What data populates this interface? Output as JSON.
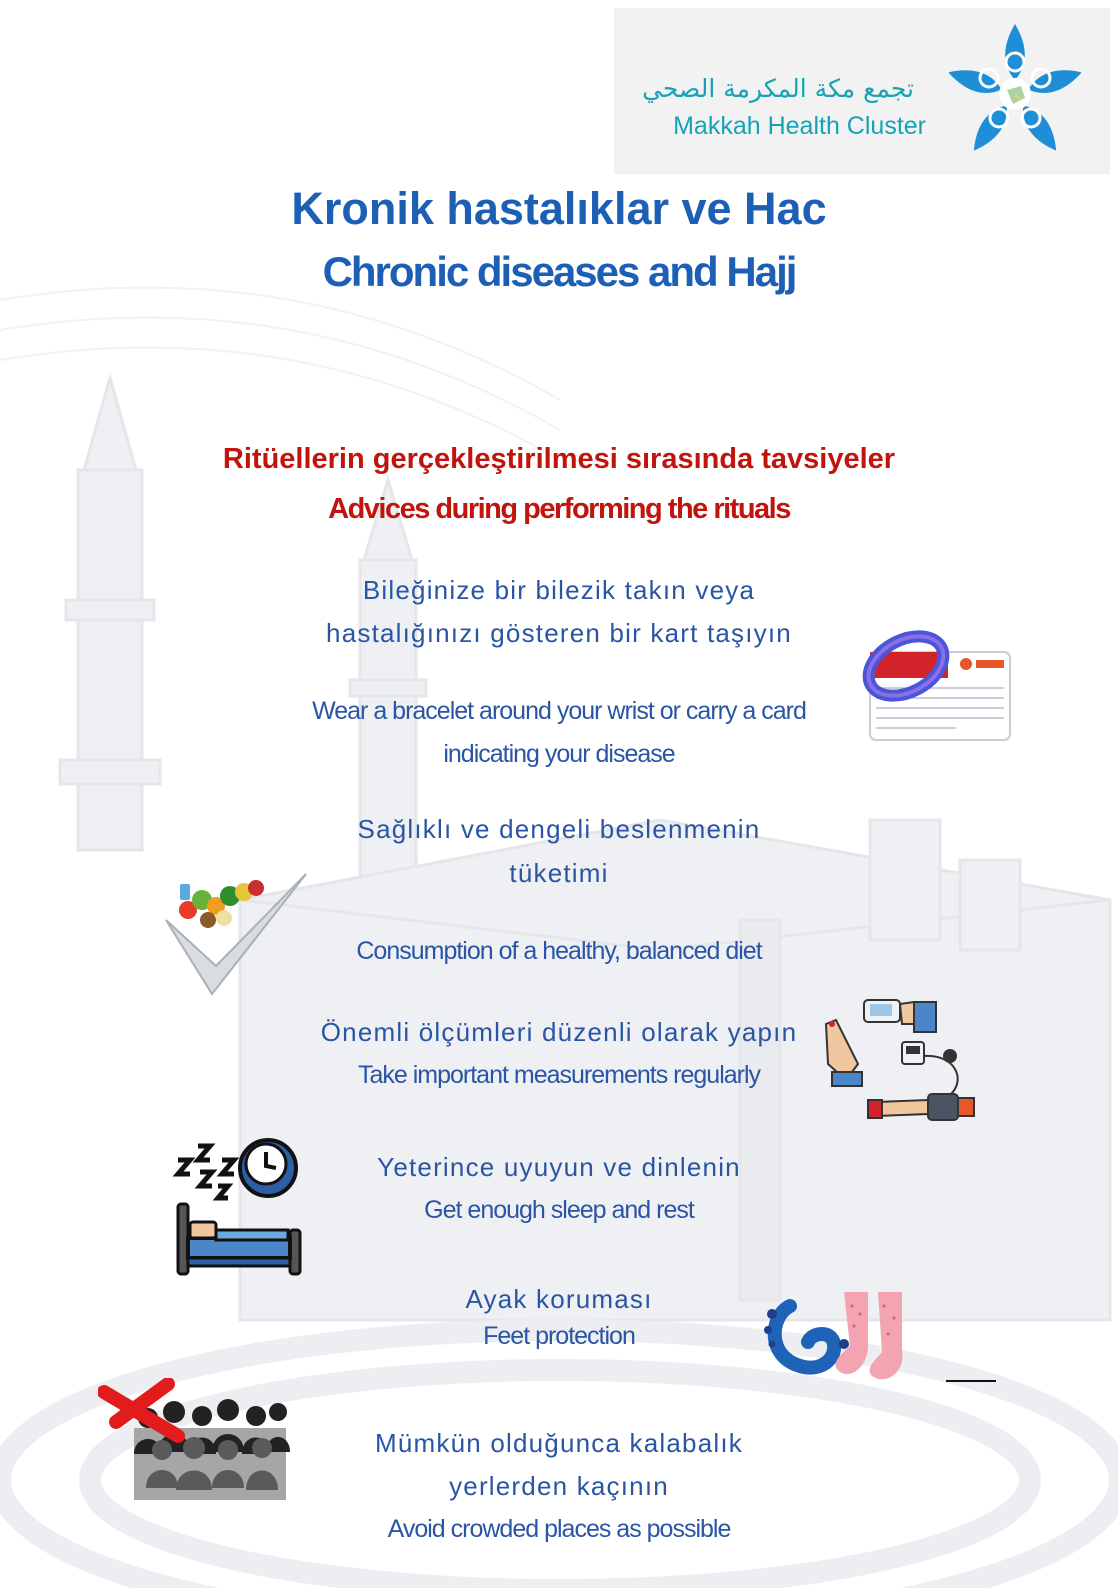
{
  "logo": {
    "arabic_name": "تجمع مكة المكرمة الصحي",
    "english_name": "Makkah Health Cluster"
  },
  "title": {
    "turkish": "Kronik hastalıklar ve Hac",
    "english": "Chronic diseases and Hajj"
  },
  "subtitle": {
    "turkish": "Ritüellerin gerçekleştirilmesi sırasında tavsiyeler",
    "english": "Advices during performing the rituals"
  },
  "advices": [
    {
      "turkish_lines": [
        "Bileğinize bir bilezik takın veya",
        "hastalığınızı gösteren bir kart taşıyın"
      ],
      "english_lines": [
        "Wear a bracelet around your wrist or carry a card",
        "indicating your disease"
      ],
      "icon": "bracelet-card-icon"
    },
    {
      "turkish_lines": [
        "Sağlıklı ve dengeli beslenmenin",
        "tüketimi"
      ],
      "english_lines": [
        "Consumption of a healthy, balanced diet"
      ],
      "icon": "healthy-food-check-icon"
    },
    {
      "turkish_lines": [
        "Önemli ölçümleri düzenli olarak yapın"
      ],
      "english_lines": [
        "Take important measurements regularly"
      ],
      "icon": "glucose-bp-measurement-icon"
    },
    {
      "turkish_lines": [
        "Yeterince uyuyun ve dinlenin"
      ],
      "english_lines": [
        "Get enough sleep and rest"
      ],
      "icon": "sleep-bed-icon"
    },
    {
      "turkish_lines": [
        "Ayak koruması"
      ],
      "english_lines": [
        "Feet protection"
      ],
      "icon": "feet-socks-icon"
    },
    {
      "turkish_lines": [
        "Mümkün olduğunca kalabalık",
        "yerlerden kaçının"
      ],
      "english_lines": [
        "Avoid crowded places as possible"
      ],
      "icon": "no-crowd-icon"
    }
  ],
  "colors": {
    "title_blue": "#1c5fb4",
    "text_blue": "#2a55a4",
    "subtitle_red": "#c0140c",
    "logo_teal": "#17a3b6",
    "logo_blue": "#1e8fd6"
  }
}
